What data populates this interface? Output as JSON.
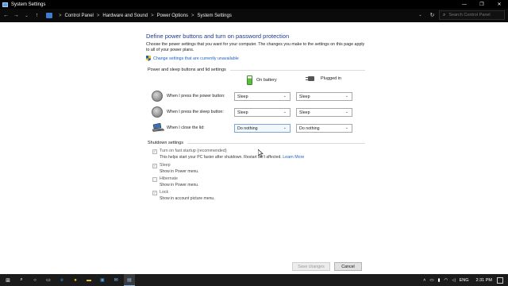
{
  "window": {
    "title": "System Settings",
    "controls": [
      "—",
      "❐",
      "✕"
    ]
  },
  "address_bar": {
    "breadcrumbs": [
      "Control Panel",
      "Hardware and Sound",
      "Power Options",
      "System Settings"
    ],
    "separator": ">",
    "search_placeholder": "Search Control Panel"
  },
  "page": {
    "title": "Define power buttons and turn on password protection",
    "description": "Choose the power settings that you want for your computer. The changes you make to the settings on this page apply to all of your power plans.",
    "admin_link": "Change settings that are currently unavailable"
  },
  "power_section": {
    "title": "Power and sleep buttons and lid settings",
    "col_battery": "On battery",
    "col_plugged": "Plugged in",
    "rows": [
      {
        "label": "When I press the power button:",
        "battery": "Sleep",
        "plugged": "Sleep",
        "icon": "power-button-icon"
      },
      {
        "label": "When I press the sleep button:",
        "battery": "Sleep",
        "plugged": "Sleep",
        "icon": "sleep-button-icon"
      },
      {
        "label": "When I close the lid:",
        "battery": "Do nothing",
        "plugged": "Do nothing",
        "icon": "laptop-lid-icon"
      }
    ]
  },
  "shutdown_section": {
    "title": "Shutdown settings",
    "items": [
      {
        "label": "Turn on fast startup (recommended)",
        "sub": "This helps start your PC faster after shutdown. Restart isn't affected.",
        "link": "Learn More",
        "checked": true
      },
      {
        "label": "Sleep",
        "sub": "Show in Power menu.",
        "checked": true
      },
      {
        "label": "Hibernate",
        "sub": "Show in Power menu.",
        "checked": false
      },
      {
        "label": "Lock",
        "sub": "Show in account picture menu.",
        "checked": true
      }
    ]
  },
  "footer": {
    "save": "Save changes",
    "cancel": "Cancel"
  },
  "taskbar": {
    "lang": "ENG",
    "time": "2:31 PM"
  },
  "colors": {
    "title_blue": "#1e3a8a",
    "link_blue": "#1a63c4",
    "taskbar": "#1b1b1b"
  }
}
